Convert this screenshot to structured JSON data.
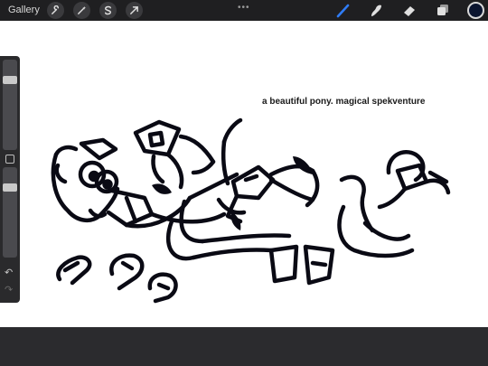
{
  "topbar": {
    "gallery_label": "Gallery",
    "left_tools": [
      "wrench-icon",
      "magic-wand-icon",
      "selection-icon",
      "transform-arrow-icon"
    ],
    "more_dots": "•••",
    "right_tools": [
      "brush-icon",
      "smudge-icon",
      "eraser-icon",
      "layers-icon"
    ],
    "active_tool": "brush-icon",
    "current_color": "#0b1530"
  },
  "canvas": {
    "caption": "a beautiful pony. magical spekventure",
    "background": "#ffffff"
  },
  "sidebar": {
    "brush_size_level": 0.8,
    "opacity_level": 0.8,
    "undo_glyph": "↶",
    "redo_glyph": "↷"
  },
  "colors": {
    "ui_dark": "#1f1f21",
    "accent_blue": "#2f7cf6",
    "ink": "#0a0a14"
  }
}
